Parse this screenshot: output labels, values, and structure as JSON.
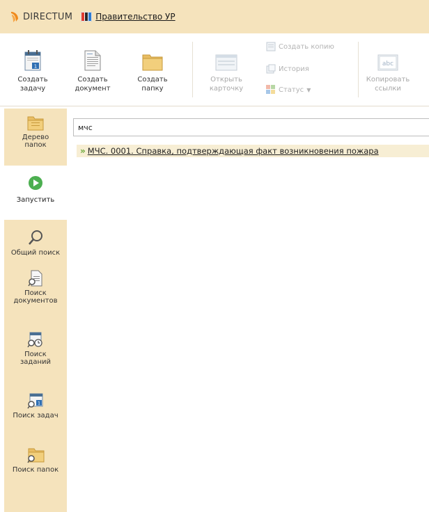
{
  "header": {
    "logo_text": "DIRECTUM",
    "org_name": "Правительство УР"
  },
  "ribbon": {
    "create_task": "Создать\nзадачу",
    "create_document": "Создать\nдокумент",
    "create_folder": "Создать\nпапку",
    "open_card": "Открыть\nкарточку",
    "create_copy": "Создать копию",
    "history": "История",
    "status": "Статус",
    "copy_links": "Копировать\nссылки"
  },
  "sidebar": {
    "folder_tree": "Дерево\nпапок",
    "run": "Запустить",
    "general_search": "Общий поиск",
    "doc_search": "Поиск\nдокументов",
    "assignment_search": "Поиск\nзаданий",
    "task_search": "Поиск задач",
    "folder_search": "Поиск папок"
  },
  "search": {
    "value": "мчс"
  },
  "results": [
    {
      "title": "МЧС. 0001. Справка, подтверждающая факт возникновения пожара"
    }
  ],
  "colors": {
    "accent_bg": "#f5e3bc",
    "run_green": "#4caf50",
    "logo_orange": "#f08a1c"
  }
}
